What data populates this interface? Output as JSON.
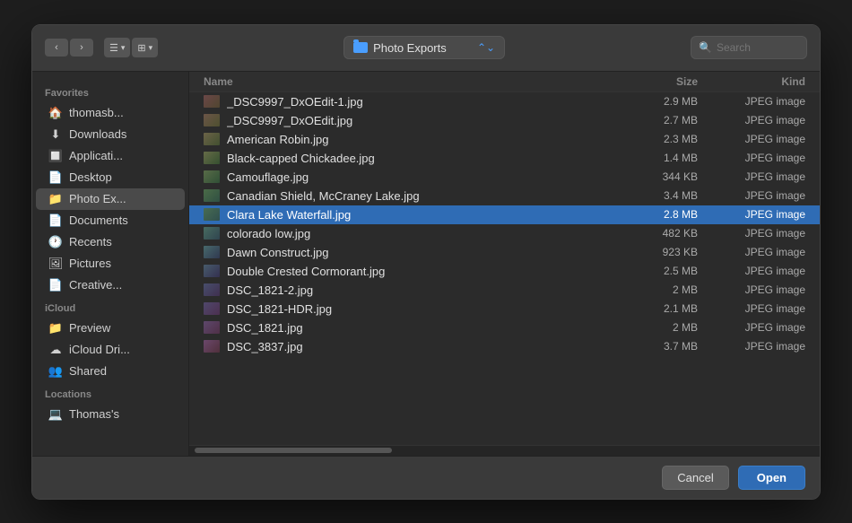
{
  "toolbar": {
    "back_label": "‹",
    "forward_label": "›",
    "view_list_label": "☰",
    "view_list_chevron": "▾",
    "view_grid_label": "⊞",
    "view_grid_chevron": "▾",
    "location_name": "Photo Exports",
    "search_placeholder": "Search"
  },
  "sidebar": {
    "sections": [
      {
        "label": "Favorites",
        "items": [
          {
            "id": "thomasb",
            "label": "thomasb...",
            "icon": "🏠"
          },
          {
            "id": "downloads",
            "label": "Downloads",
            "icon": "⬇"
          },
          {
            "id": "applications",
            "label": "Applicati...",
            "icon": "🔲"
          },
          {
            "id": "desktop",
            "label": "Desktop",
            "icon": "📄"
          },
          {
            "id": "photo-exports",
            "label": "Photo Ex...",
            "icon": "📁",
            "active": true
          },
          {
            "id": "documents",
            "label": "Documents",
            "icon": "📄"
          },
          {
            "id": "recents",
            "label": "Recents",
            "icon": "🕐"
          },
          {
            "id": "pictures",
            "label": "Pictures",
            "icon": "🖼"
          },
          {
            "id": "creative",
            "label": "Creative...",
            "icon": "📄"
          }
        ]
      },
      {
        "label": "iCloud",
        "items": [
          {
            "id": "preview",
            "label": "Preview",
            "icon": "📁"
          },
          {
            "id": "icloud-drive",
            "label": "iCloud Dri...",
            "icon": "☁"
          },
          {
            "id": "shared",
            "label": "Shared",
            "icon": "👥"
          }
        ]
      },
      {
        "label": "Locations",
        "items": [
          {
            "id": "thomass",
            "label": "Thomas's",
            "icon": "💻"
          }
        ]
      }
    ]
  },
  "file_list": {
    "columns": {
      "name": "Name",
      "size": "Size",
      "kind": "Kind"
    },
    "files": [
      {
        "name": "_DSC9997_DxOEdit-1.jpg",
        "size": "2.9 MB",
        "kind": "JPEG image",
        "selected": false
      },
      {
        "name": "_DSC9997_DxOEdit.jpg",
        "size": "2.7 MB",
        "kind": "JPEG image",
        "selected": false
      },
      {
        "name": "American Robin.jpg",
        "size": "2.3 MB",
        "kind": "JPEG image",
        "selected": false
      },
      {
        "name": "Black-capped Chickadee.jpg",
        "size": "1.4 MB",
        "kind": "JPEG image",
        "selected": false
      },
      {
        "name": "Camouflage.jpg",
        "size": "344 KB",
        "kind": "JPEG image",
        "selected": false
      },
      {
        "name": "Canadian Shield, McCraney Lake.jpg",
        "size": "3.4 MB",
        "kind": "JPEG image",
        "selected": false
      },
      {
        "name": "Clara Lake Waterfall.jpg",
        "size": "2.8 MB",
        "kind": "JPEG image",
        "selected": true
      },
      {
        "name": "colorado low.jpg",
        "size": "482 KB",
        "kind": "JPEG image",
        "selected": false
      },
      {
        "name": "Dawn Construct.jpg",
        "size": "923 KB",
        "kind": "JPEG image",
        "selected": false
      },
      {
        "name": "Double Crested Cormorant.jpg",
        "size": "2.5 MB",
        "kind": "JPEG image",
        "selected": false
      },
      {
        "name": "DSC_1821-2.jpg",
        "size": "2 MB",
        "kind": "JPEG image",
        "selected": false
      },
      {
        "name": "DSC_1821-HDR.jpg",
        "size": "2.1 MB",
        "kind": "JPEG image",
        "selected": false
      },
      {
        "name": "DSC_1821.jpg",
        "size": "2 MB",
        "kind": "JPEG image",
        "selected": false
      },
      {
        "name": "DSC_3837.jpg",
        "size": "3.7 MB",
        "kind": "JPEG image",
        "selected": false
      }
    ]
  },
  "footer": {
    "cancel_label": "Cancel",
    "open_label": "Open"
  }
}
